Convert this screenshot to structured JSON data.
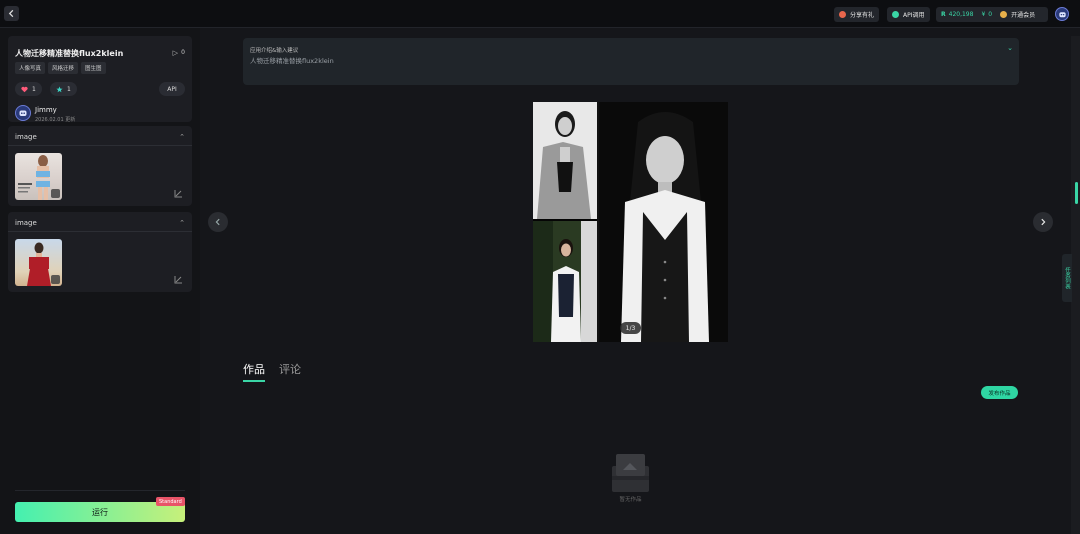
{
  "topbar": {
    "share_label": "分享有礼",
    "api_label": "API调用",
    "coins": "420,198",
    "yen_amount": "0",
    "member_label": "开通会员"
  },
  "model": {
    "title": "人物迁移精准替换flux2klein",
    "play_count": "0",
    "tags": [
      "人像写真",
      "风格迁移",
      "图生图"
    ],
    "likes": "1",
    "stars": "1",
    "api_label": "API",
    "author": "Jimmy",
    "date": "2026.02.01 更新"
  },
  "inputs": [
    {
      "title": "image"
    },
    {
      "title": "image"
    }
  ],
  "run": {
    "label": "运行",
    "badge": "Standard"
  },
  "intro": {
    "heading": "应用介绍&输入建议",
    "text": "人物迁移精准替换flux2klein"
  },
  "gallery": {
    "page_indicator": "1/3"
  },
  "tabs": {
    "works": "作品",
    "comments": "评论"
  },
  "publish_label": "发布作品",
  "empty_text": "暂无作品",
  "side_tab_label": "任务列表",
  "colors": {
    "accent": "#3ad6a6",
    "run_gradient_start": "#44f0b0",
    "run_gradient_end": "#c7f07a",
    "badge": "#e85468"
  }
}
